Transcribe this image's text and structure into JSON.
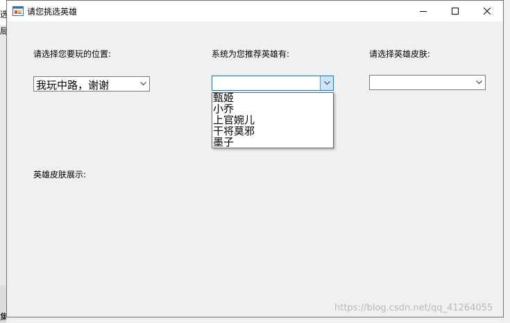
{
  "window": {
    "title": "请您挑选英雄",
    "minimize_label": "Minimize",
    "maximize_label": "Maximize",
    "close_label": "Close"
  },
  "position_selector": {
    "label": "请选择您要玩的位置:",
    "selected": "我玩中路，谢谢"
  },
  "hero_selector": {
    "label": "系统为您推荐英雄有:",
    "selected": "",
    "options": [
      "甄姬",
      "小乔",
      "上官婉儿",
      "干将莫邪",
      "墨子"
    ]
  },
  "skin_selector": {
    "label": "请选择英雄皮肤:",
    "selected": ""
  },
  "skin_display": {
    "label": "英雄皮肤展示:"
  },
  "background": {
    "glyph_top": "选",
    "glyph_second": "局",
    "glyph_bottom": "集"
  },
  "watermark": "https://blog.csdn.net/qq_41264055",
  "colors": {
    "window_bg": "#f0f0f0",
    "titlebar_bg": "#ffffff",
    "focus_blue": "#0078d7",
    "dropdown_arrow_bg": "#cce4f7"
  }
}
